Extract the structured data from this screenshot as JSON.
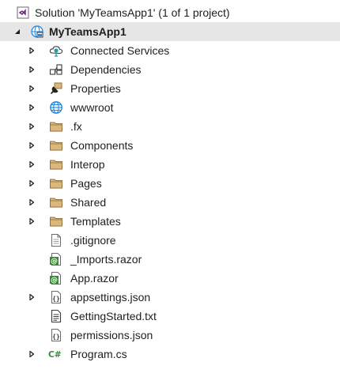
{
  "solution": {
    "label": "Solution 'MyTeamsApp1' (1 of 1 project)"
  },
  "project": {
    "label": "MyTeamsApp1",
    "expanded": true
  },
  "items": [
    {
      "label": "Connected Services",
      "icon": "connected-services-icon",
      "expandable": true
    },
    {
      "label": "Dependencies",
      "icon": "dependencies-icon",
      "expandable": true
    },
    {
      "label": "Properties",
      "icon": "properties-wrench-icon",
      "expandable": true
    },
    {
      "label": "wwwroot",
      "icon": "globe-icon",
      "expandable": true
    },
    {
      "label": ".fx",
      "icon": "folder-icon",
      "expandable": true
    },
    {
      "label": "Components",
      "icon": "folder-icon",
      "expandable": true
    },
    {
      "label": "Interop",
      "icon": "folder-icon",
      "expandable": true
    },
    {
      "label": "Pages",
      "icon": "folder-icon",
      "expandable": true
    },
    {
      "label": "Shared",
      "icon": "folder-icon",
      "expandable": true
    },
    {
      "label": "Templates",
      "icon": "folder-icon",
      "expandable": true
    },
    {
      "label": ".gitignore",
      "icon": "text-file-icon",
      "expandable": false
    },
    {
      "label": "_Imports.razor",
      "icon": "razor-file-icon",
      "expandable": false
    },
    {
      "label": "App.razor",
      "icon": "razor-file-icon",
      "expandable": false
    },
    {
      "label": "appsettings.json",
      "icon": "json-file-icon",
      "expandable": true
    },
    {
      "label": "GettingStarted.txt",
      "icon": "txt-file-icon",
      "expandable": false
    },
    {
      "label": "permissions.json",
      "icon": "json-file-icon",
      "expandable": false
    },
    {
      "label": "Program.cs",
      "icon": "csharp-file-icon",
      "expandable": true
    }
  ],
  "colors": {
    "selected_row": "#e6e6e6",
    "folder": "#dcb67a",
    "folder_border": "#8f7542",
    "csharp": "#388a34",
    "globe": "#1e88e5",
    "vs_purple": "#68217a"
  }
}
